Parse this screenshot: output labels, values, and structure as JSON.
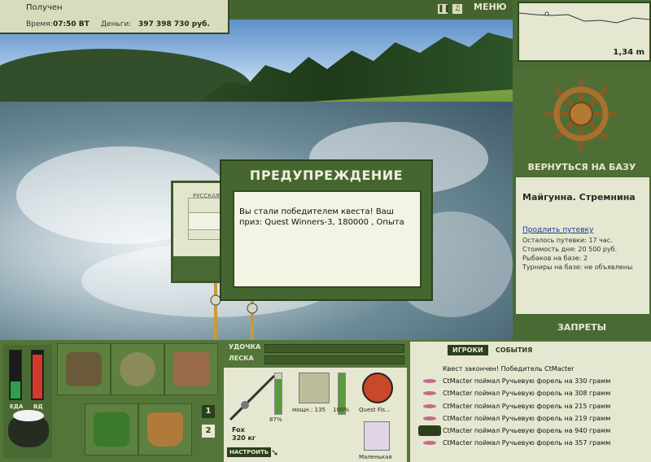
{
  "status": {
    "received": "Получен",
    "time_label": "Время:",
    "time_value": "07:50 ВТ",
    "money_label": "Деньги:",
    "money_value": "397 398 730 руб."
  },
  "topbar": {
    "menu_label": "МЕНЮ",
    "pause_icon": "pause-icon",
    "sound_icon": "speaker-icon"
  },
  "minimap": {
    "depth": "1,34 m"
  },
  "base": {
    "return_label": "ВЕРНУТЬСЯ НА БАЗУ",
    "name": "Майгунна. Стремнина",
    "extend_link": "Продлить путевку",
    "info": [
      "Осталось путевки: 17 час.",
      "Стоимость дня: 20 500 руб.",
      "Рыбаков на базе: 2",
      "Турниры на базе: не объявлены"
    ],
    "bans_label": "ЗАПРЕТЫ"
  },
  "background_dialog": {
    "label": "РУССКАЯ"
  },
  "dialog": {
    "title": "ПРЕДУПРЕЖДЕНИЕ",
    "message": "Вы стали победителем квеста! Ваш приз: Quest Winners-3, 180000 , Опыта"
  },
  "gauges": {
    "food_label": "ЕДА",
    "food_level": 0.35,
    "thirst_label": "ВД",
    "thirst_level": 0.9
  },
  "inventory": {
    "page1": "1",
    "page2": "2"
  },
  "rods": {
    "rod_label": "УДОЧКА",
    "line_label": "ЛЕСКА"
  },
  "tackle": {
    "rod_name": "Fox",
    "rod_weight": "320 кг",
    "rod_percent": "87%",
    "reel_power": "мощн.: 135",
    "reel_percent": "100%",
    "line_name": "Quest Fis...",
    "lure_name": "Маленькая",
    "setup_label": "НАСТРОИТЬ"
  },
  "events": {
    "tab_players": "ИГРОКИ",
    "tab_events": "СОБЫТИЯ",
    "items": [
      "Квест закончен! Победитель CtMacter",
      "CtMacter поймал Ручьевую форель на 330 грамм",
      "CtMacter поймал Ручьевую форель на 308 грамм",
      "CtMacter поймал Ручьевую форель на 215 грамм",
      "CtMacter поймал Ручьевую форель на 219 грамм",
      "CtMacter поймал Ручьевую форель на 940 грамм",
      "CtMacter поймал Ручьевую форель на 357 грамм"
    ]
  }
}
